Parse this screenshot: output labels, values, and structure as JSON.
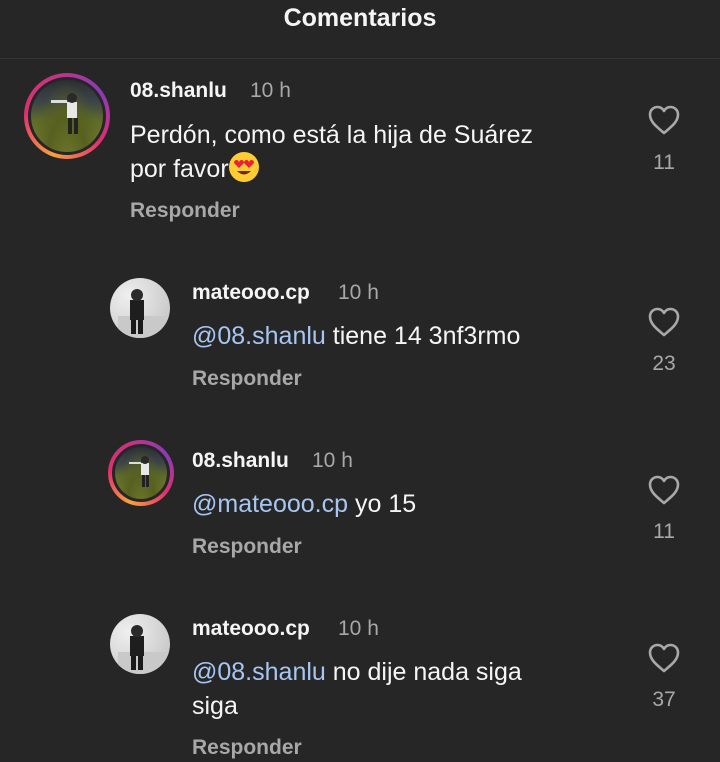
{
  "header": {
    "title": "Comentarios"
  },
  "comments": [
    {
      "username": "08.shanlu",
      "time": "10 h",
      "text_line1": "Perdón, como está la hija de Suárez",
      "text_line2": "por favor",
      "emoji": "heart-eyes",
      "reply_label": "Responder",
      "likes": "11",
      "story_ring": true
    },
    {
      "username": "mateooo.cp",
      "time": "10 h",
      "mention": "@08.shanlu",
      "text": " tiene 14 3nf3rmo",
      "reply_label": "Responder",
      "likes": "23",
      "story_ring": false
    },
    {
      "username": "08.shanlu",
      "time": "10 h",
      "mention": "@mateooo.cp",
      "text": " yo 15",
      "reply_label": "Responder",
      "likes": "11",
      "story_ring": true
    },
    {
      "username": "mateooo.cp",
      "time": "10 h",
      "mention": "@08.shanlu",
      "text_line1": " no dije nada siga",
      "text_line2": "siga",
      "reply_label": "Responder",
      "likes": "37",
      "story_ring": false
    }
  ],
  "colors": {
    "background": "#262627",
    "mention": "#a7c7f2",
    "secondary": "#a8a8a8"
  }
}
